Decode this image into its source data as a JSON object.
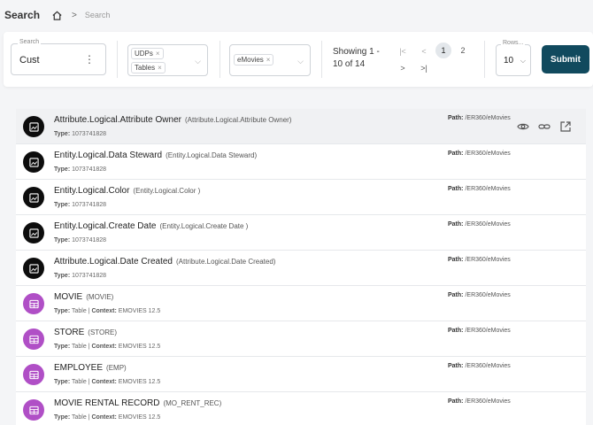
{
  "header": {
    "title": "Search",
    "breadcrumb": "Search"
  },
  "filters": {
    "search_legend": "Search",
    "search_value": "Cust",
    "types": [
      "UDPs",
      "Tables"
    ],
    "models": [
      "eMovies"
    ],
    "showing_line1": "Showing 1 -",
    "showing_line2": "10 of 14",
    "pages": [
      "1",
      "2"
    ],
    "rows_legend": "Rows...",
    "rows_value": "10",
    "submit_label": "Submit"
  },
  "results": [
    {
      "icon": "attribute-icon",
      "name": "Attribute.Logical.Attribute Owner",
      "alias": "(Attribute.Logical.Attribute Owner)",
      "type_label": "Type:",
      "type": "1073741828",
      "context_label": "",
      "context": "",
      "path_label": "Path:",
      "path": "/ER360/eMovies"
    },
    {
      "icon": "attribute-icon",
      "name": "Entity.Logical.Data Steward",
      "alias": "(Entity.Logical.Data Steward)",
      "type_label": "Type:",
      "type": "1073741828",
      "context_label": "",
      "context": "",
      "path_label": "Path:",
      "path": "/ER360/eMovies"
    },
    {
      "icon": "attribute-icon",
      "name": "Entity.Logical.Color",
      "alias": "(Entity.Logical.Color )",
      "type_label": "Type:",
      "type": "1073741828",
      "context_label": "",
      "context": "",
      "path_label": "Path:",
      "path": "/ER360/eMovies"
    },
    {
      "icon": "attribute-icon",
      "name": "Entity.Logical.Create Date",
      "alias": "(Entity.Logical.Create Date )",
      "type_label": "Type:",
      "type": "1073741828",
      "context_label": "",
      "context": "",
      "path_label": "Path:",
      "path": "/ER360/eMovies"
    },
    {
      "icon": "attribute-icon",
      "name": "Attribute.Logical.Date Created",
      "alias": "(Attribute.Logical.Date Created)",
      "type_label": "Type:",
      "type": "1073741828",
      "context_label": "",
      "context": "",
      "path_label": "Path:",
      "path": "/ER360/eMovies"
    },
    {
      "icon": "table-icon",
      "name": "MOVIE",
      "alias": "(MOVIE)",
      "type_label": "Type:",
      "type": "Table",
      "context_label": "Context:",
      "context": "EMOVIES 12.5",
      "path_label": "Path:",
      "path": "/ER360/eMovies"
    },
    {
      "icon": "table-icon",
      "name": "STORE",
      "alias": "(STORE)",
      "type_label": "Type:",
      "type": "Table",
      "context_label": "Context:",
      "context": "EMOVIES 12.5",
      "path_label": "Path:",
      "path": "/ER360/eMovies"
    },
    {
      "icon": "table-icon",
      "name": "EMPLOYEE",
      "alias": "(EMP)",
      "type_label": "Type:",
      "type": "Table",
      "context_label": "Context:",
      "context": "EMOVIES 12.5",
      "path_label": "Path:",
      "path": "/ER360/eMovies"
    },
    {
      "icon": "table-icon",
      "name": "MOVIE RENTAL RECORD",
      "alias": "(MO_RENT_REC)",
      "type_label": "Type:",
      "type": "Table",
      "context_label": "Context:",
      "context": "EMOVIES 12.5",
      "path_label": "Path:",
      "path": "/ER360/eMovies"
    }
  ]
}
